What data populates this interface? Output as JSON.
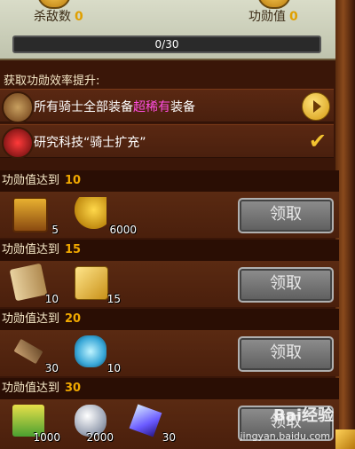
{
  "stats": {
    "kills_label": "杀敌数",
    "kills_value": "0",
    "merit_label": "功勋值",
    "merit_value": "0"
  },
  "progress": {
    "text": "0/30",
    "fraction": 0
  },
  "boost": {
    "title": "获取功勋效率提升:",
    "rows": [
      {
        "text_before": "所有骑士全部装备",
        "highlight": "超稀有",
        "text_after": "装备"
      },
      {
        "text": "研究科技“骑士扩充”"
      }
    ]
  },
  "rewards": [
    {
      "label": "功勋值达到",
      "level": "10",
      "items": [
        {
          "icon": "treasure-chest-icon",
          "count": "5"
        },
        {
          "icon": "golden-feather-icon",
          "count": "6000"
        }
      ],
      "button": "领取"
    },
    {
      "label": "功勋值达到",
      "level": "15",
      "items": [
        {
          "icon": "scroll-icon",
          "count": "10"
        },
        {
          "icon": "gold-box-icon",
          "count": "15"
        }
      ],
      "button": "领取"
    },
    {
      "label": "功勋值达到",
      "level": "20",
      "items": [
        {
          "icon": "scroll-star-icon",
          "count": "30"
        },
        {
          "icon": "ice-dragon-icon",
          "count": "10"
        }
      ],
      "button": "领取"
    },
    {
      "label": "功勋值达到",
      "level": "30",
      "items": [
        {
          "icon": "green-book-icon",
          "count": "1000"
        },
        {
          "icon": "silver-gem-icon",
          "count": "2000"
        },
        {
          "icon": "blue-crystal-icon",
          "count": "30"
        }
      ],
      "button": "领取"
    }
  ],
  "watermark": {
    "brand": "Bai经验",
    "url": "jingyan.baidu.com"
  },
  "colors": {
    "accent": "#f0a800",
    "highlight": "#ff4de1",
    "panel": "#4a1f0c"
  }
}
